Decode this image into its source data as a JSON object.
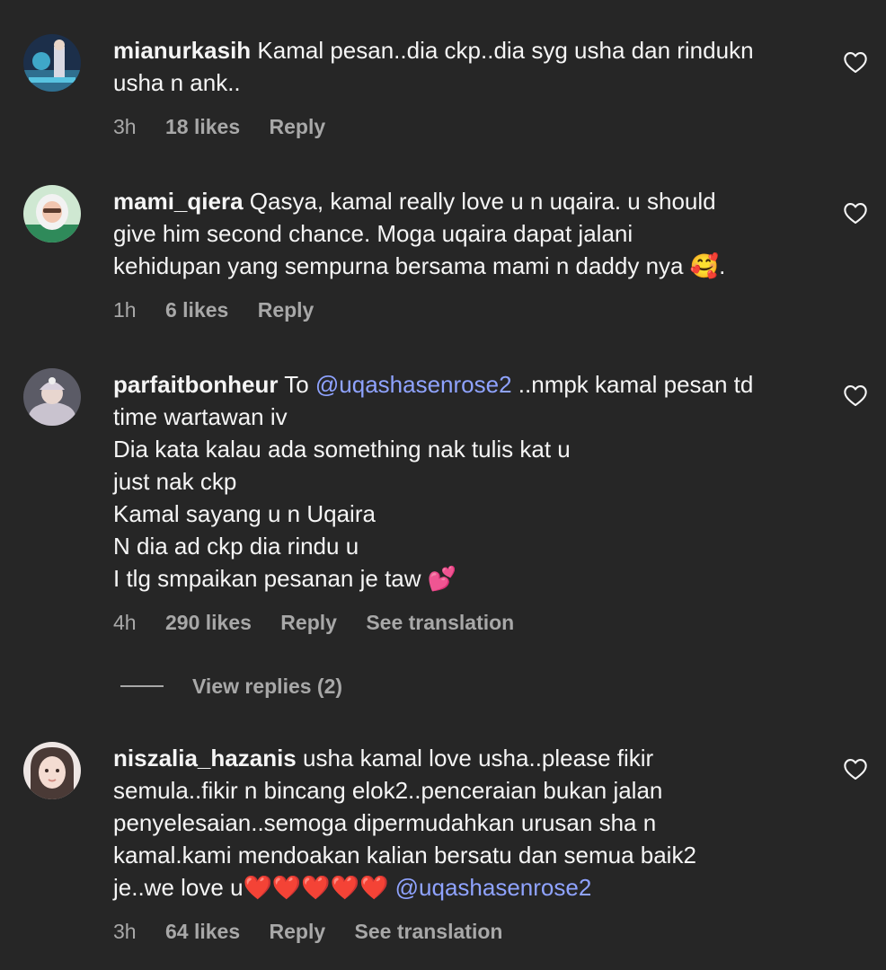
{
  "comments": [
    {
      "username": "mianurkasih",
      "lines": [
        "Kamal pesan..dia ckp..dia syg usha dan rindukn",
        "usha n ank.."
      ],
      "time": "3h",
      "likes": "18 likes",
      "reply": "Reply"
    },
    {
      "username": "mami_qiera",
      "lines": [
        "Qasya, kamal really love u n uqaira. u should",
        "give him second chance. Moga uqaira dapat jalani",
        "kehidupan yang sempurna bersama mami n daddy nya 🥰."
      ],
      "time": "1h",
      "likes": "6 likes",
      "reply": "Reply"
    },
    {
      "username": "parfaitbonheur",
      "first_prefix": "To ",
      "mention": "@uqashasenrose2",
      "first_suffix": " ..nmpk kamal pesan td",
      "lines": [
        "time wartawan iv",
        "Dia kata kalau ada something nak tulis kat u",
        "just nak ckp",
        "Kamal sayang u n Uqaira",
        "N dia ad ckp dia rindu u",
        "I tlg smpaikan pesanan je taw 💕"
      ],
      "time": "4h",
      "likes": "290 likes",
      "reply": "Reply",
      "translate": "See translation",
      "view_replies": "View replies (2)"
    },
    {
      "username": "niszalia_hazanis",
      "lines": [
        "usha kamal love usha..please fikir",
        "semula..fikir n bincang elok2..penceraian bukan jalan",
        "penyelesaian..semoga dipermudahkan urusan sha n",
        "kamal.kami mendoakan kalian bersatu dan semua baik2"
      ],
      "last_prefix": "je..we love u❤️❤️❤️❤️❤️ ",
      "mention": "@uqashasenrose2",
      "time": "3h",
      "likes": "64 likes",
      "reply": "Reply",
      "translate": "See translation"
    }
  ],
  "icons": {
    "like": "heart-outline-icon"
  },
  "colors": {
    "background": "#262626",
    "text": "#f5f5f5",
    "secondary": "#a8a8a8",
    "mention": "#8fa3ff"
  }
}
